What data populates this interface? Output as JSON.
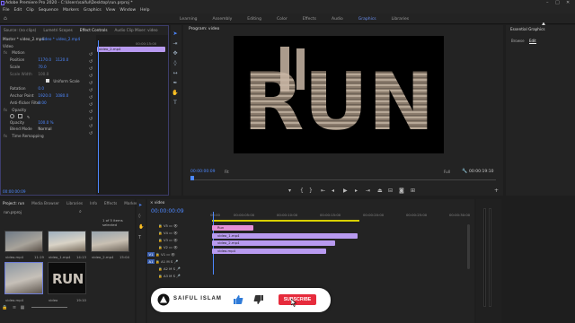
{
  "window": {
    "title": "Adobe Premiere Pro 2020 - C:\\Users\\saiful\\Desktop\\run.prproj *"
  },
  "menu": [
    "File",
    "Edit",
    "Clip",
    "Sequence",
    "Markers",
    "Graphics",
    "View",
    "Window",
    "Help"
  ],
  "workspaces": {
    "items": [
      "Learning",
      "Assembly",
      "Editing",
      "Color",
      "Effects",
      "Audio",
      "Graphics",
      "Libraries"
    ],
    "active_index": 6
  },
  "source_panel": {
    "tabs": [
      "Source: (no clips)",
      "Lumetri Scopes",
      "Effect Controls",
      "Audio Clip Mixer: video"
    ],
    "active_index": 2
  },
  "effect_controls": {
    "master": "Master * video_2.mp4",
    "clip": "video * video_2.mp4",
    "timecode": "00:00:15:00",
    "clip_label": "video_2.mp4",
    "section_video": "Video",
    "motion": "Motion",
    "rows": [
      {
        "label": "Position",
        "v1": "1170.0",
        "v2": "1120.0"
      },
      {
        "label": "Scale",
        "v1": "70.0",
        "v2": ""
      },
      {
        "label": "Scale Width",
        "v1": "100.0",
        "v2": ""
      },
      {
        "label": "Uniform Scale",
        "v1": "",
        "v2": ""
      },
      {
        "label": "Rotation",
        "v1": "0.0",
        "v2": ""
      },
      {
        "label": "Anchor Point",
        "v1": "1920.0",
        "v2": "1080.0"
      },
      {
        "label": "Anti-flicker Filter",
        "v1": "0.00",
        "v2": ""
      }
    ],
    "opacity_section": "Opacity",
    "opacity_value": "100.0 %",
    "blend_label": "Blend Mode",
    "blend_value": "Normal",
    "time_remap": "Time Remapping",
    "bottom_time": "00:00:00:09"
  },
  "program": {
    "title": "Program: video",
    "overlay_text": "RUN",
    "timecode_left": "00:00:00:09",
    "fit": "Fit",
    "full": "Full",
    "timecode_right": "00:00:19:10"
  },
  "essential_graphics": {
    "title": "Essential Graphics",
    "tabs": [
      "Browse",
      "Edit"
    ],
    "active_index": 1
  },
  "project": {
    "tabs": [
      "Project: run",
      "Media Browser",
      "Libraries",
      "Info",
      "Effects",
      "Markers"
    ],
    "name": "run.prproj",
    "count": "1 of 5 items selected",
    "items": [
      {
        "name": "video.mp4",
        "dur": "11:19"
      },
      {
        "name": "video_1.mp4",
        "dur": "14:13"
      },
      {
        "name": "video_2.mp4",
        "dur": "15:04"
      },
      {
        "name": "video.mp4",
        "dur": ""
      },
      {
        "name": "video",
        "dur": "19:10"
      }
    ]
  },
  "timeline": {
    "tab": "video",
    "timecode": "00:00:00:09",
    "ruler": [
      "00:00",
      "00:00:05:00",
      "00:00:10:00",
      "00:00:15:00",
      "00:00:20:00",
      "00:00:25:00",
      "00:00:30:00"
    ],
    "tracks": [
      "V5",
      "V4",
      "V3",
      "V2",
      "V1",
      "A1",
      "A2",
      "A3"
    ],
    "clips": [
      "Run",
      "video_1.mp4",
      "video_2.mp4",
      "video.mp4"
    ]
  },
  "subscribe_banner": {
    "channel": "SAIFUL ISLAM",
    "button": "SUBSCRIBE"
  },
  "colors": {
    "accent": "#4d88ff",
    "clip_pink": "#e58fd8",
    "clip_purple": "#b89af0",
    "subscribe_red": "#e62b3c"
  }
}
